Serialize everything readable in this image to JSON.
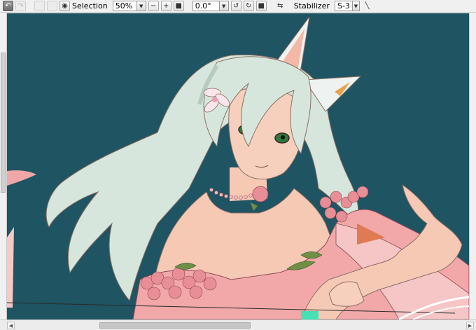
{
  "toolbar": {
    "selection_label": "Selection",
    "zoom_value": "50%",
    "rotation_value": "0.0°",
    "stabilizer_label": "Stabilizer",
    "stabilizer_value": "S-3"
  },
  "icons": {
    "undo": "undo-icon",
    "redo": "redo-icon",
    "eye": "eye-icon",
    "zoom_out": "minus-icon",
    "zoom_in": "plus-icon",
    "rotate_ccw": "rotate-ccw-icon",
    "rotate_cw": "rotate-cw-icon",
    "flip": "flip-icon",
    "pen": "pen-icon"
  },
  "colors": {
    "canvas_bg": "#1f5462",
    "hair": "#d6e6dc",
    "skin": "#f6c9b5",
    "dress": "#f2a8a8",
    "flower": "#e88e96",
    "leaf": "#6f8f47"
  }
}
